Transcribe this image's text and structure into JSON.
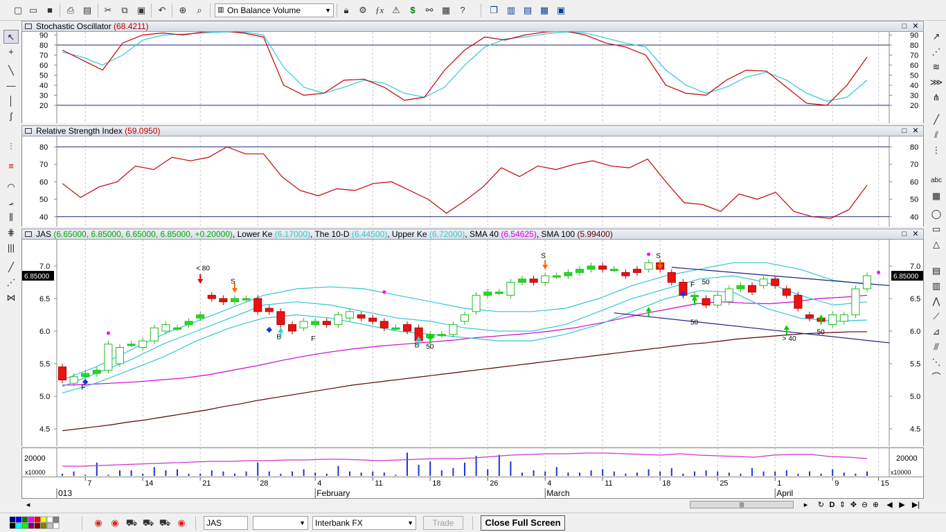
{
  "toolbar": {
    "buttons": [
      "new-file-icon",
      "open-folder-icon",
      "save-icon",
      "print-icon",
      "print-preview-icon",
      "cut-icon",
      "copy-icon",
      "paste-icon",
      "undo-icon",
      "crosshair-icon",
      "zoom-icon"
    ],
    "indicator_select": "On Balance Volume",
    "right_buttons": [
      "lock-icon",
      "indicator-builder-icon",
      "function-icon",
      "alert-icon",
      "dollar-icon",
      "binoculars-icon",
      "explorer-icon",
      "help-icon",
      "window-cascade-icon",
      "tile-vertical-icon",
      "tile-horizontal-icon",
      "tile-grid-icon",
      "fullscreen-icon"
    ]
  },
  "panels": {
    "stochastic": {
      "label": "Stochastic Oscillator",
      "value": "(68.4211)",
      "ticks": [
        "90",
        "80",
        "70",
        "60",
        "50",
        "40",
        "30",
        "20"
      ]
    },
    "rsi": {
      "label": "Relative Strength Index",
      "value": "(59.0950)",
      "ticks": [
        "80",
        "70",
        "60",
        "50",
        "40"
      ]
    },
    "price": {
      "symbol": "JAS",
      "ohlc": "(6.65000, 6.85000, 6.65000, 6.85000, +0.20000)",
      "lower_label": "Lower Ke",
      "lower_value": "(6.17000)",
      "mid_label": "The 10-D",
      "mid_value": "(6.44500)",
      "upper_label": "Upper Ke",
      "upper_value": "(6.72000)",
      "sma40_label": "SMA 40",
      "sma40_value": "(6.54625)",
      "sma100_label": "SMA 100",
      "sma100_value": "(5.99400)",
      "last_price": "6.85000",
      "ticks": [
        "7.0",
        "6.5",
        "6.0",
        "5.5",
        "5.0",
        "4.5"
      ],
      "annotations": [
        "< 80",
        "S",
        "S",
        "S",
        "B",
        "F",
        "B",
        "50",
        "F",
        "50",
        "F",
        "50",
        "> 40",
        "50"
      ]
    },
    "volume": {
      "tick": "20000",
      "multiplier": "x10000",
      "right_tick": "20000",
      "right_multiplier": "x10000"
    }
  },
  "timeline": {
    "days": [
      "7",
      "14",
      "21",
      "28",
      "4",
      "11",
      "18",
      "26",
      "4",
      "11",
      "18",
      "25",
      "1",
      "9",
      "15"
    ],
    "months": [
      "013",
      "February",
      "March",
      "April"
    ]
  },
  "statusbar": {
    "symbol": "JAS",
    "blank_select": "",
    "datafeed": "Interbank FX",
    "trade_label": "Trade",
    "close_fullscreen_label": "Close Full Screen"
  },
  "chart_data": {
    "type": "candlestick",
    "title": "JAS",
    "ylim": [
      4.3,
      7.3
    ],
    "x": [
      "Jan 3",
      "Jan 4",
      "Jan 7",
      "Jan 8",
      "Jan 9",
      "Jan 10",
      "Jan 11",
      "Jan 14",
      "Jan 15",
      "Jan 16",
      "Jan 17",
      "Jan 18",
      "Jan 21",
      "Jan 22",
      "Jan 23",
      "Jan 24",
      "Jan 25",
      "Jan 28",
      "Jan 29",
      "Jan 30",
      "Jan 31",
      "Feb 1",
      "Feb 4",
      "Feb 5",
      "Feb 6",
      "Feb 7",
      "Feb 8",
      "Feb 11",
      "Feb 12",
      "Feb 13",
      "Feb 14",
      "Feb 15",
      "Feb 18",
      "Feb 19",
      "Feb 20",
      "Feb 21",
      "Feb 22",
      "Feb 25",
      "Feb 26",
      "Feb 27",
      "Feb 28",
      "Mar 1",
      "Mar 4",
      "Mar 5",
      "Mar 6",
      "Mar 7",
      "Mar 8",
      "Mar 11",
      "Mar 12",
      "Mar 13",
      "Mar 14",
      "Mar 15",
      "Mar 18",
      "Mar 19",
      "Mar 20",
      "Mar 21",
      "Mar 22",
      "Mar 25",
      "Mar 26",
      "Mar 27",
      "Mar 28",
      "Mar 29",
      "Apr 1",
      "Apr 2",
      "Apr 3",
      "Apr 4",
      "Apr 5",
      "Apr 8",
      "Apr 9",
      "Apr 10",
      "Apr 11"
    ],
    "open": [
      5.45,
      5.2,
      5.3,
      5.35,
      5.4,
      5.5,
      5.8,
      5.75,
      5.85,
      6.0,
      6.05,
      6.1,
      6.2,
      6.55,
      6.5,
      6.45,
      6.5,
      6.5,
      6.35,
      6.3,
      6.1,
      6.05,
      6.1,
      6.15,
      6.1,
      6.2,
      6.25,
      6.2,
      6.15,
      6.05,
      6.1,
      6.05,
      5.9,
      5.95,
      5.95,
      6.15,
      6.3,
      6.55,
      6.6,
      6.55,
      6.75,
      6.8,
      6.75,
      6.85,
      6.85,
      6.9,
      6.95,
      7.0,
      6.95,
      6.9,
      6.95,
      6.95,
      7.05,
      6.9,
      6.75,
      6.55,
      6.5,
      6.4,
      6.45,
      6.65,
      6.7,
      6.7,
      6.8,
      6.65,
      6.55,
      6.25,
      6.2,
      6.1,
      6.15,
      6.25,
      6.65
    ],
    "close": [
      5.25,
      5.3,
      5.35,
      5.4,
      5.8,
      5.75,
      5.8,
      5.85,
      6.05,
      6.1,
      6.05,
      6.15,
      6.25,
      6.5,
      6.45,
      6.5,
      6.5,
      6.3,
      6.3,
      6.1,
      6.0,
      6.15,
      6.15,
      6.1,
      6.25,
      6.3,
      6.2,
      6.15,
      6.05,
      6.05,
      6.0,
      5.85,
      5.95,
      5.95,
      6.1,
      6.25,
      6.55,
      6.6,
      6.6,
      6.75,
      6.8,
      6.75,
      6.85,
      6.85,
      6.9,
      6.95,
      7.0,
      6.95,
      6.95,
      6.85,
      6.9,
      7.05,
      6.95,
      6.75,
      6.55,
      6.55,
      6.4,
      6.55,
      6.65,
      6.7,
      6.6,
      6.8,
      6.7,
      6.55,
      6.35,
      6.2,
      6.15,
      6.25,
      6.25,
      6.65,
      6.85
    ],
    "series_sma100": [
      4.47,
      4.5,
      4.53,
      4.56,
      4.6,
      4.63,
      4.67,
      4.71,
      4.75,
      4.79,
      4.84,
      4.88,
      4.93,
      4.97,
      5.01,
      5.05,
      5.09,
      5.13,
      5.17,
      5.2,
      5.23,
      5.26,
      5.29,
      5.32,
      5.35,
      5.38,
      5.41,
      5.44,
      5.47,
      5.5,
      5.53,
      5.56,
      5.59,
      5.62,
      5.65,
      5.68,
      5.71,
      5.74,
      5.77,
      5.8,
      5.82,
      5.85,
      5.88,
      5.9,
      5.92,
      5.94,
      5.96,
      5.97,
      5.98,
      5.99,
      5.99
    ]
  }
}
